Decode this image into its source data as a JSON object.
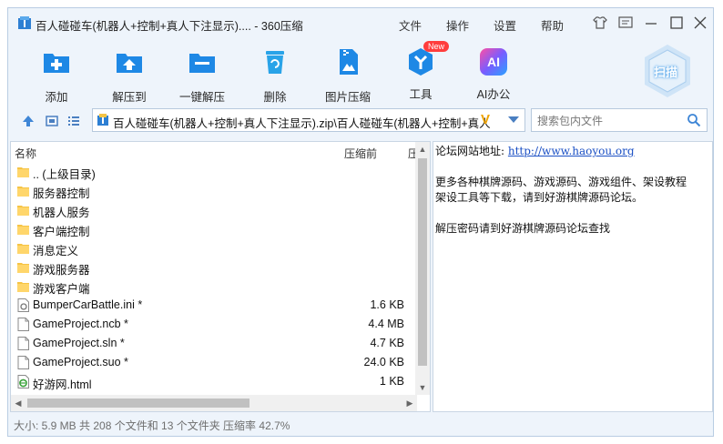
{
  "window": {
    "title": "百人碰碰车(机器人+控制+真人下注显示).... - 360压缩",
    "menu": [
      "文件",
      "操作",
      "设置",
      "帮助"
    ]
  },
  "toolbar": {
    "items": [
      {
        "label": "添加",
        "icon": "add-icon"
      },
      {
        "label": "解压到",
        "icon": "extract-to-icon"
      },
      {
        "label": "一键解压",
        "icon": "one-click-extract-icon"
      },
      {
        "label": "删除",
        "icon": "delete-icon"
      },
      {
        "label": "图片压缩",
        "icon": "image-compress-icon"
      },
      {
        "label": "工具",
        "icon": "tools-icon",
        "badge": "New"
      },
      {
        "label": "AI办公",
        "icon": "ai-office-icon",
        "icon_text": "AI"
      }
    ],
    "scan_label": "扫描"
  },
  "address": {
    "path": "百人碰碰车(机器人+控制+真人下注显示).zip\\百人碰碰车(机器人+控制+真人"
  },
  "search": {
    "placeholder": "搜索包内文件"
  },
  "file_list": {
    "columns": {
      "name": "名称",
      "compressed": "压缩前",
      "extra": "压"
    },
    "rows": [
      {
        "name": ".. (上级目录)",
        "type": "folder",
        "size": ""
      },
      {
        "name": "服务器控制",
        "type": "folder",
        "size": ""
      },
      {
        "name": "机器人服务",
        "type": "folder",
        "size": ""
      },
      {
        "name": "客户端控制",
        "type": "folder",
        "size": ""
      },
      {
        "name": "消息定义",
        "type": "folder",
        "size": ""
      },
      {
        "name": "游戏服务器",
        "type": "folder",
        "size": ""
      },
      {
        "name": "游戏客户端",
        "type": "folder",
        "size": ""
      },
      {
        "name": "BumperCarBattle.ini *",
        "type": "ini",
        "size": "1.6 KB"
      },
      {
        "name": "GameProject.ncb *",
        "type": "file",
        "size": "4.4 MB"
      },
      {
        "name": "GameProject.sln *",
        "type": "file",
        "size": "4.7 KB"
      },
      {
        "name": "GameProject.suo *",
        "type": "file",
        "size": "24.0 KB"
      },
      {
        "name": "好游网.html",
        "type": "html",
        "size": "1 KB"
      }
    ]
  },
  "comment": {
    "line1_label": "论坛网站地址:",
    "line1_link": "http://www.haoyou.org",
    "line2": "更多各种棋牌源码、游戏源码、游戏组件、架设教程",
    "line3": "架设工具等下载，请到好游棋牌源码论坛。",
    "line4": "解压密码请到好游棋牌源码论坛查找"
  },
  "status": {
    "text": "大小: 5.9 MB 共 208 个文件和 13 个文件夹 压缩率 42.7%"
  },
  "colors": {
    "accent_blue": "#1e88e5",
    "folder_yellow": "#f6c445",
    "badge_red": "#ff3d3d"
  }
}
